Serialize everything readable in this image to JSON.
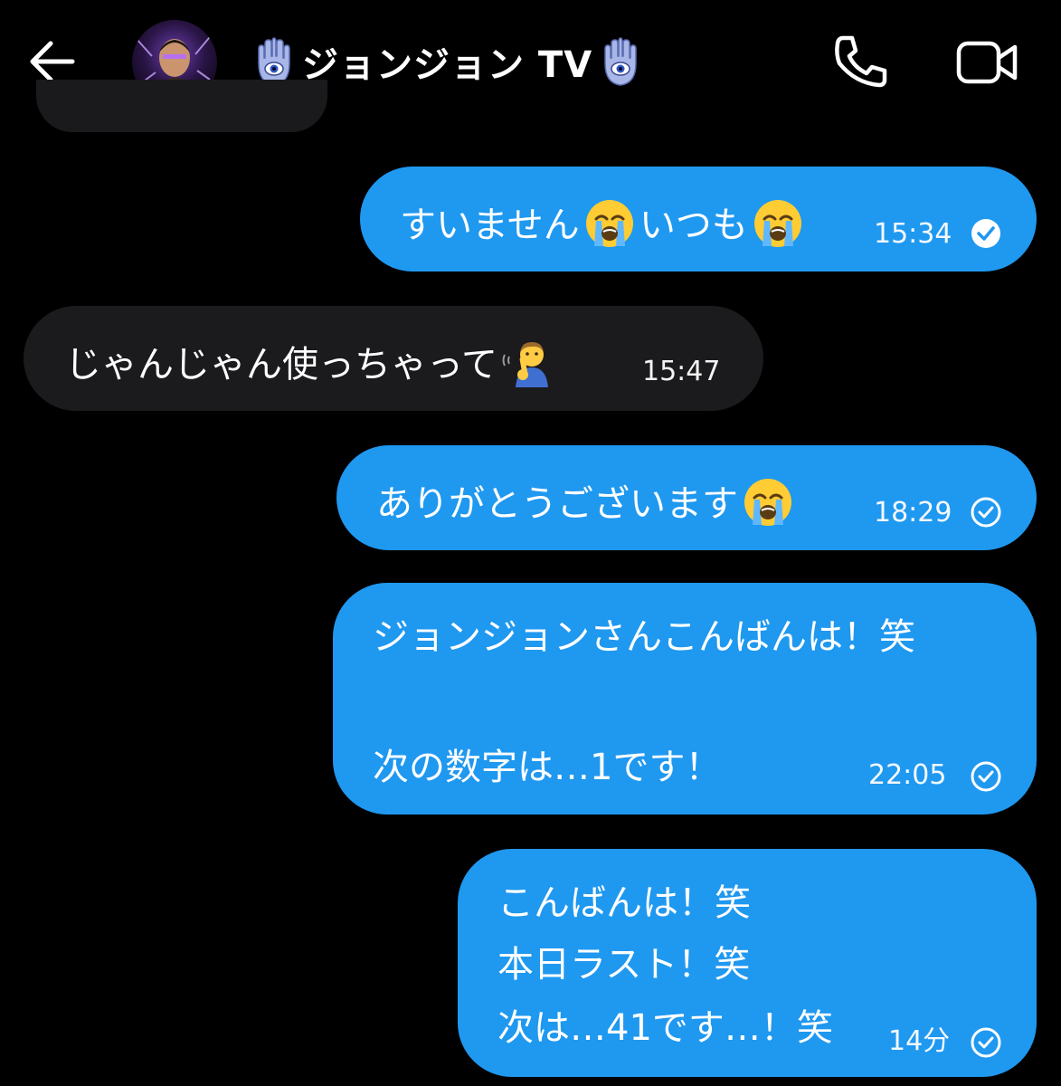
{
  "header": {
    "back_icon": "arrow-left-icon",
    "title": "ジョンジョン TV",
    "title_icon": "hamsa-eye-icon",
    "call_icon": "phone-icon",
    "video_icon": "video-camera-icon"
  },
  "colors": {
    "background": "#000000",
    "outgoing_bubble": "#1f98f0",
    "incoming_bubble": "#1b1b1d",
    "text": "#ffffff"
  },
  "messages": [
    {
      "direction": "outgoing",
      "parts": [
        "すいません",
        "いつも"
      ],
      "emoji": "loudly-crying-face-icon",
      "time": "15:34",
      "status": "read-filled-check"
    },
    {
      "direction": "incoming",
      "parts": [
        "じゃんじゃん使っちゃって"
      ],
      "emoji": "shushing-person-icon",
      "time": "15:47"
    },
    {
      "direction": "outgoing",
      "parts": [
        "ありがとうございます"
      ],
      "emoji": "loudly-crying-face-icon",
      "time": "18:29",
      "status": "sent-outline-check"
    },
    {
      "direction": "outgoing",
      "lines": [
        "ジョンジョンさんこんばんは！笑",
        "次の数字は…1です！"
      ],
      "time": "22:05",
      "status": "sent-outline-check"
    },
    {
      "direction": "outgoing",
      "lines": [
        "こんばんは！笑",
        "本日ラスト！笑",
        "次は…41です…！笑"
      ],
      "time": "14分",
      "status": "sent-outline-check"
    }
  ]
}
